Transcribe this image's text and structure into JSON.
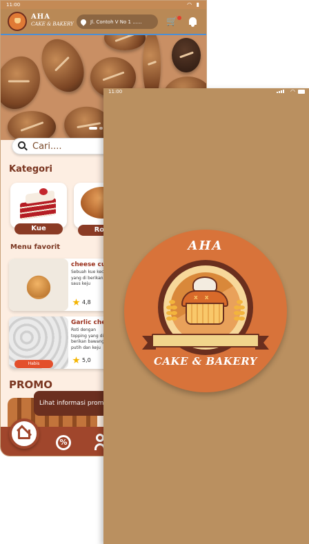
{
  "home_screen": {
    "status_bar": {
      "time": "11:00"
    },
    "header": {
      "brand_line1": "AHA",
      "brand_line2": "CAKE & BAKERY",
      "location": "Jl. Contoh V No 1 ......",
      "cart_icon": "cart-icon",
      "notification_icon": "bell-icon"
    },
    "search": {
      "placeholder": "Cari...."
    },
    "categories_title": "Kategori",
    "categories": [
      {
        "label": "Kue",
        "icon": "cake-image"
      },
      {
        "label": "Roti",
        "icon": "bread-image"
      }
    ],
    "favorites_title": "Menu favorit",
    "favorites": [
      {
        "name": "cheese cupcake",
        "desc": "Sebuah kue kecil yang di berikan saus keju",
        "rating": "4,8"
      },
      {
        "name": "Garlic cheese",
        "desc": "Roti dengan topping yang di berikan bawang putih dan keju",
        "rating": "5,0",
        "badge": "Habis"
      }
    ],
    "promo_title": "PROMO",
    "promo_banner": "Lihat informasi promo",
    "nav": {
      "home_icon": "home-icon",
      "discount_icon": "discount-icon",
      "discount_glyph": "%",
      "profile_icon": "user-icon"
    }
  },
  "splash_screen": {
    "status_bar": {
      "time": "11:00"
    },
    "logo_title": "AHA",
    "logo_subtitle": "CAKE & BAKERY"
  },
  "colors": {
    "brand_brown": "#a0462c",
    "header_tan": "#b98956",
    "splash_bg": "#ba9060",
    "logo_orange": "#d8733a",
    "accent_red": "#e34f2b"
  }
}
